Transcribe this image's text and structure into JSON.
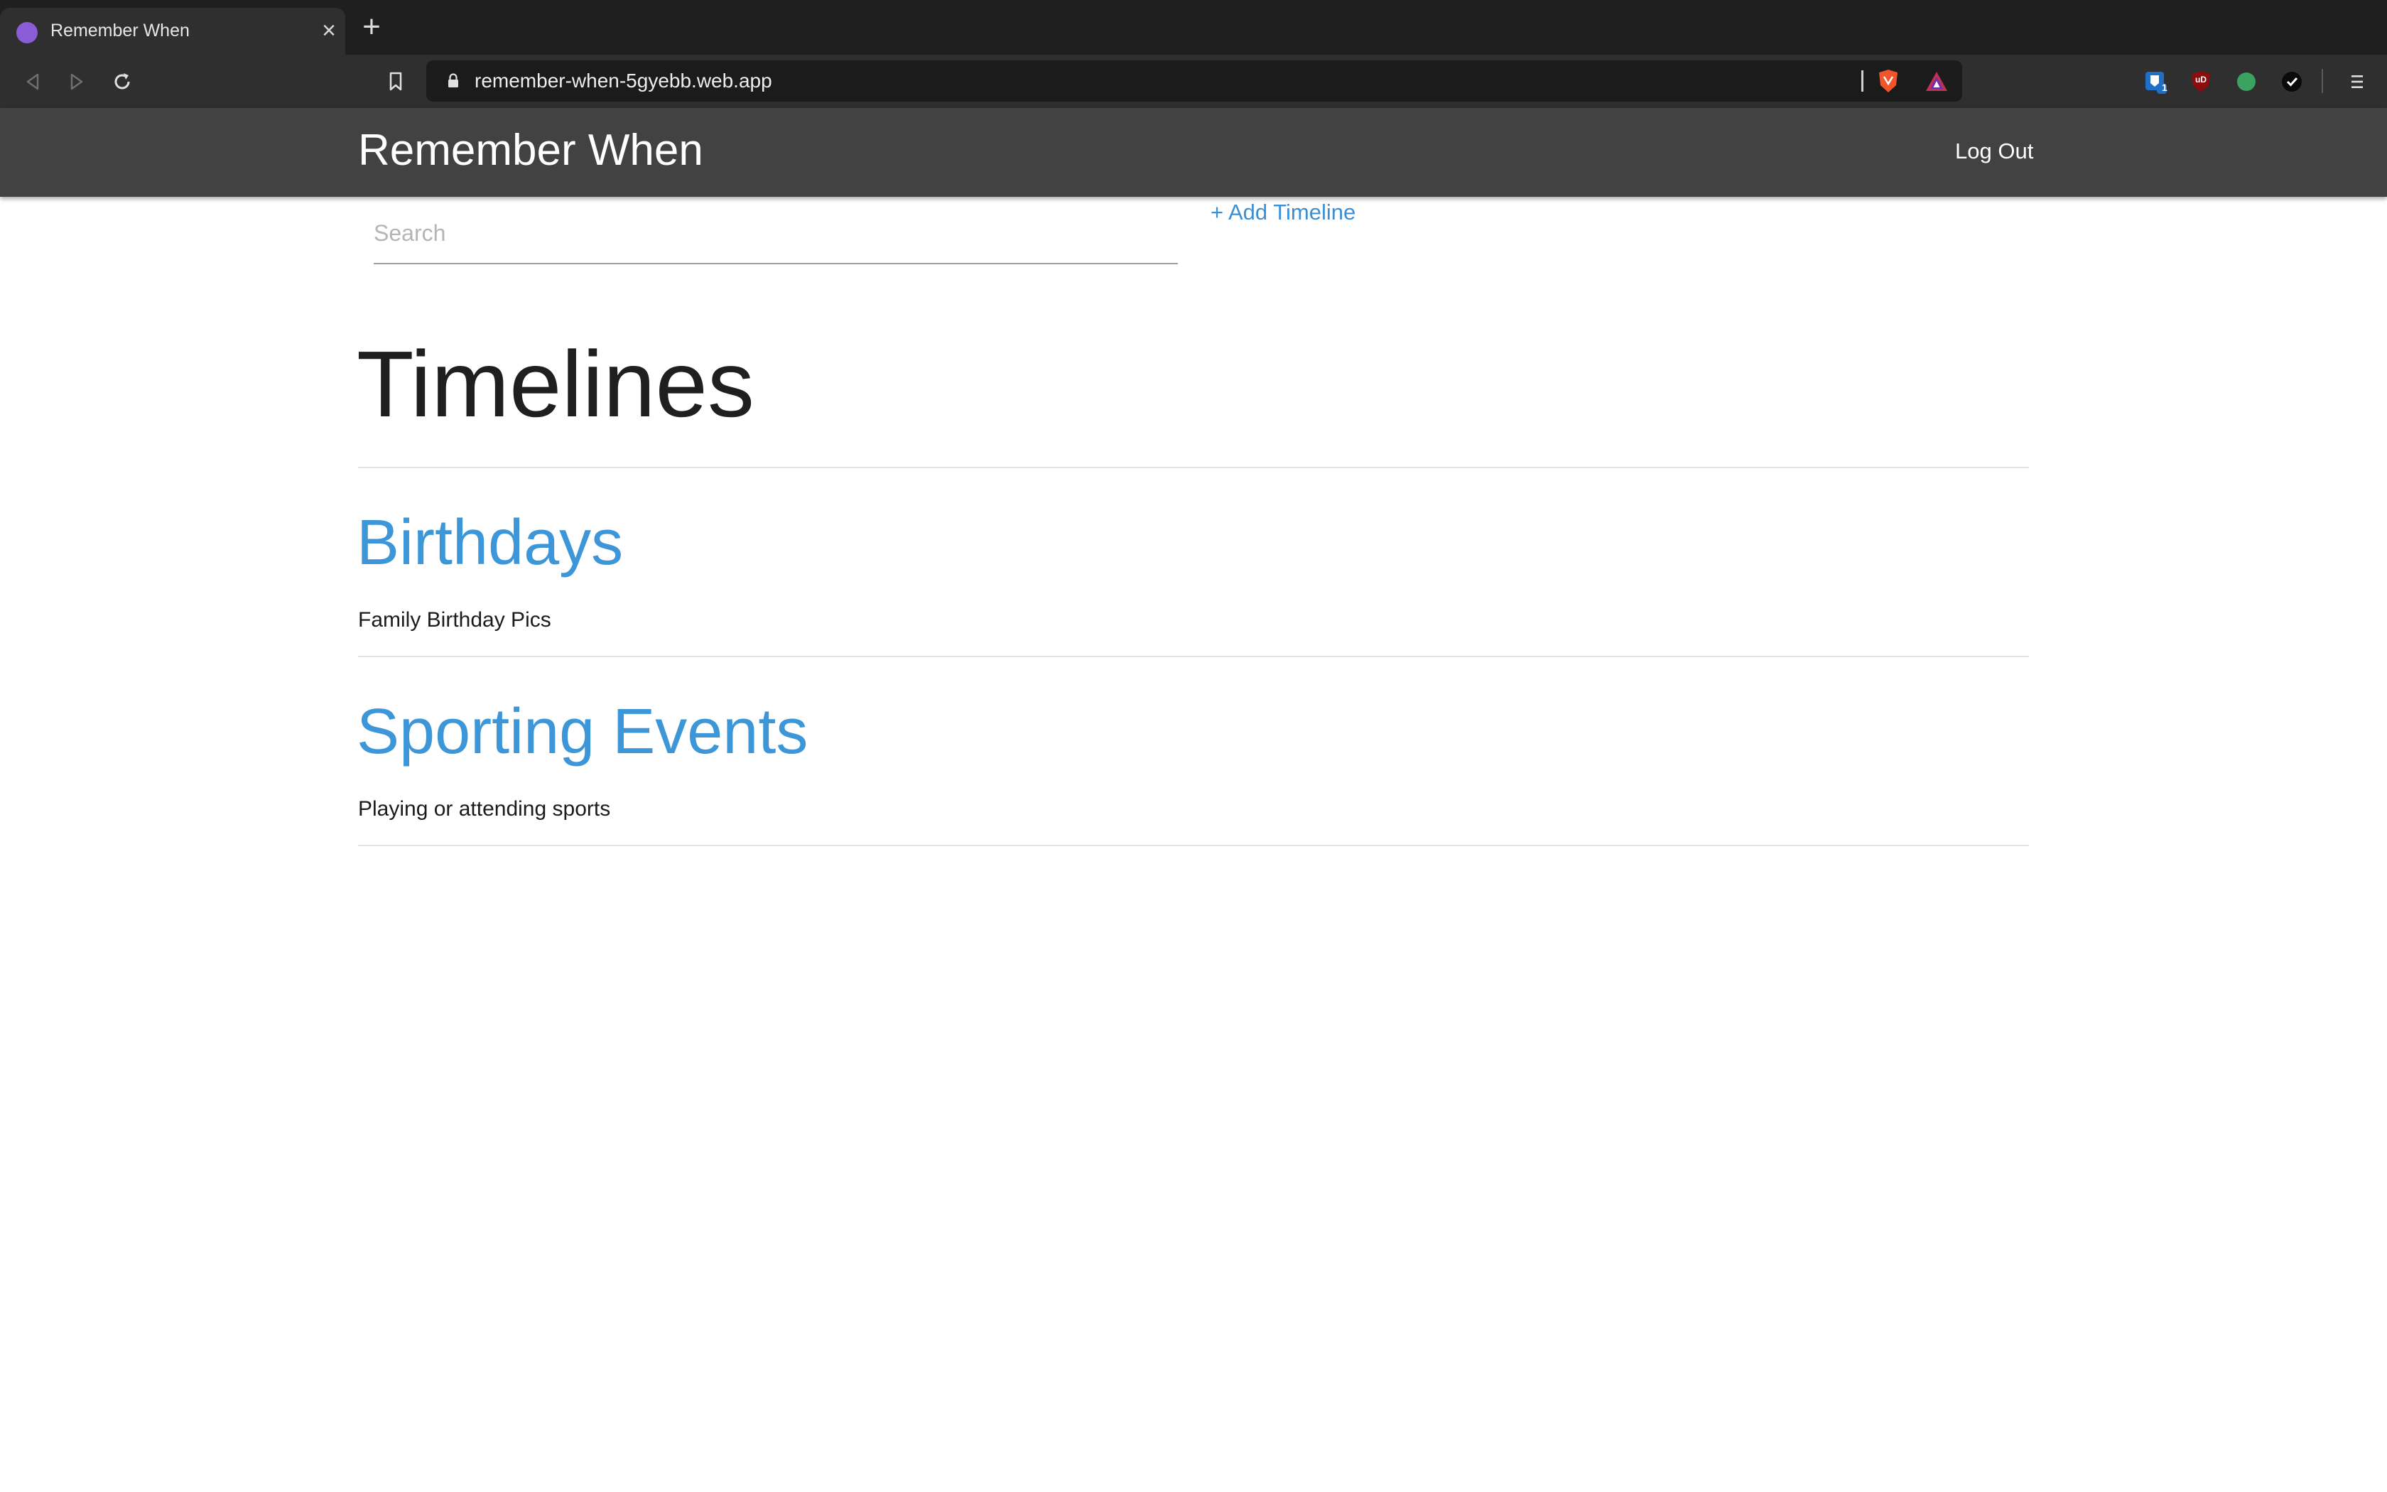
{
  "browser": {
    "tab": {
      "title": "Remember When",
      "close": "×"
    },
    "new_tab": "+",
    "url": "remember-when-5gyebb.web.app",
    "extension_badge": "1",
    "ublock_label": "uD"
  },
  "app": {
    "brand": "Remember When",
    "logout_label": "Log Out"
  },
  "toolbar": {
    "search_placeholder": "Search",
    "add_timeline_label": "+ Add Timeline"
  },
  "main": {
    "heading": "Timelines",
    "timelines": [
      {
        "title": "Birthdays",
        "description": "Family Birthday Pics"
      },
      {
        "title": "Sporting Events",
        "description": "Playing or attending sports"
      }
    ]
  },
  "colors": {
    "link": "#3d96d8",
    "appbar": "#424242",
    "favicon": "#8a5cd6"
  }
}
